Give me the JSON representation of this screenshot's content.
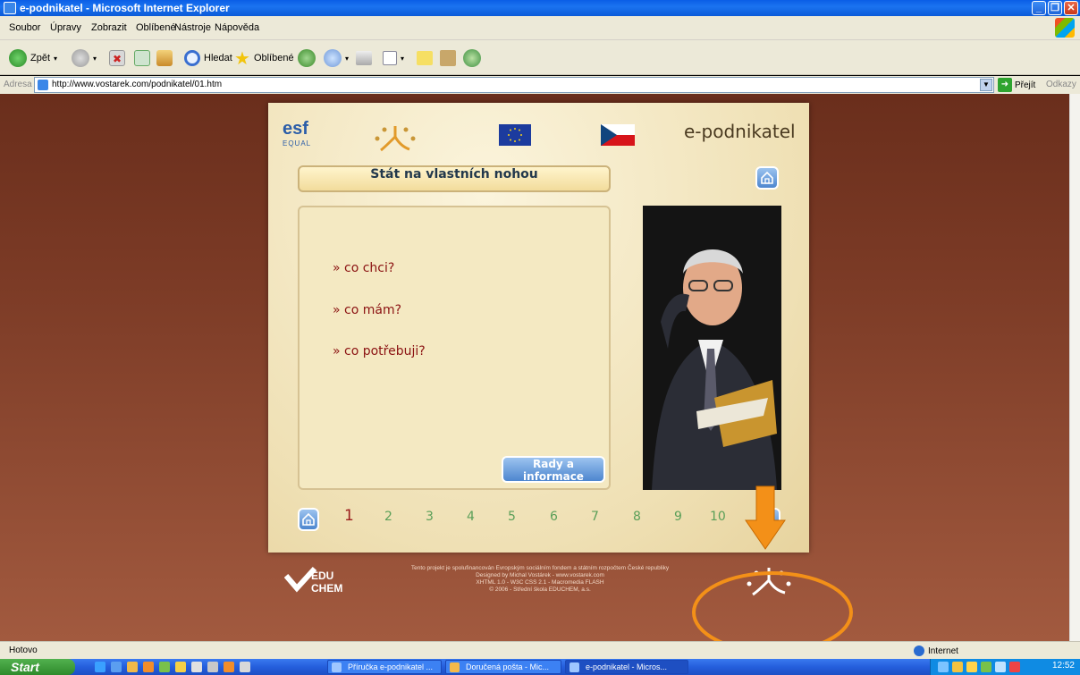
{
  "window": {
    "title": "e-podnikatel - Microsoft Internet Explorer"
  },
  "menu": [
    "Soubor",
    "Úpravy",
    "Zobrazit",
    "Oblíbené",
    "Nástroje",
    "Nápověda"
  ],
  "toolbar": {
    "back_label": "Zpět",
    "search_label": "Hledat",
    "favorites_label": "Oblíbené"
  },
  "address": {
    "label": "Adresa",
    "url": "http://www.vostarek.com/podnikatel/01.htm",
    "go_label": "Přejít",
    "links_label": "Odkazy"
  },
  "page": {
    "brand": "e-podnikatel",
    "esf": "esf",
    "equal": "EQUAL",
    "heading": "Stát na vlastních nohou",
    "items": [
      "» co chci?",
      "» co mám?",
      "» co potřebuji?"
    ],
    "rady": "Rady a informace",
    "pages": [
      "1",
      "2",
      "3",
      "4",
      "5",
      "6",
      "7",
      "8",
      "9",
      "10"
    ],
    "current_page": "1",
    "next_label": ">>",
    "footer_logo": "EDU CHEM",
    "footer_lines": [
      "Tento projekt je spolufinancován Evropským sociálním fondem a státním rozpočtem České republiky",
      "Designed by Michal Vostárek - www.vostarek.com",
      "XHTML 1.0 - W3C CSS 2.1 - Macromedia FLASH",
      "© 2006 - Střední škola EDUCHEM, a.s."
    ]
  },
  "annotation": {
    "color": "#f39018"
  },
  "status": {
    "left": "Hotovo",
    "zone": "Internet"
  },
  "taskbar": {
    "start": "Start",
    "items": [
      "Příručka e-podnikatel ...",
      "Doručená pošta - Mic...",
      "e-podnikatel - Micros..."
    ],
    "clock": "12:52"
  }
}
